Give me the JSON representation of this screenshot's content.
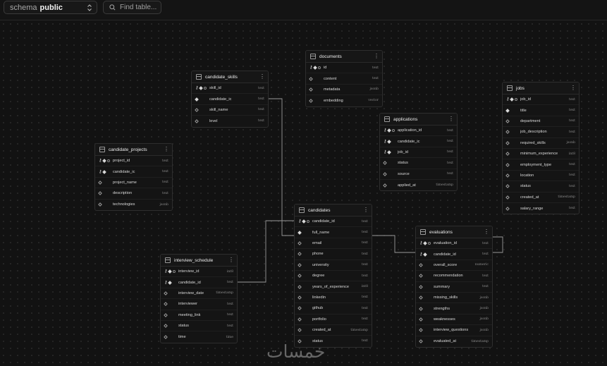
{
  "toolbar": {
    "schema_label": "schema",
    "schema_value": "public",
    "find_placeholder": "Find table..."
  },
  "tables": {
    "documents": {
      "name": "documents",
      "columns": [
        {
          "name": "id",
          "type": "text",
          "icons": [
            "key",
            "dia",
            "uniq"
          ]
        },
        {
          "name": "content",
          "type": "text",
          "icons": [
            "null"
          ]
        },
        {
          "name": "metadata",
          "type": "jsonb",
          "icons": [
            "null"
          ]
        },
        {
          "name": "embedding",
          "type": "vector",
          "icons": [
            "null"
          ]
        }
      ]
    },
    "candidate_skills": {
      "name": "candidate_skills",
      "columns": [
        {
          "name": "skill_id",
          "type": "text",
          "icons": [
            "key",
            "dia",
            "uniq"
          ]
        },
        {
          "name": "candidate_ic",
          "type": "text",
          "icons": [
            "dia"
          ]
        },
        {
          "name": "skill_name",
          "type": "text",
          "icons": [
            "null"
          ]
        },
        {
          "name": "level",
          "type": "text",
          "icons": [
            "null"
          ]
        }
      ]
    },
    "applications": {
      "name": "applications",
      "columns": [
        {
          "name": "application_id",
          "type": "text",
          "icons": [
            "key",
            "dia",
            "uniq"
          ]
        },
        {
          "name": "candidate_ic",
          "type": "text",
          "icons": [
            "key",
            "dia"
          ]
        },
        {
          "name": "job_id",
          "type": "text",
          "icons": [
            "key",
            "dia"
          ]
        },
        {
          "name": "status",
          "type": "text",
          "icons": [
            "null"
          ]
        },
        {
          "name": "source",
          "type": "text",
          "icons": [
            "null"
          ]
        },
        {
          "name": "applied_at",
          "type": "timestamp",
          "icons": [
            "null"
          ]
        }
      ]
    },
    "jobs": {
      "name": "jobs",
      "columns": [
        {
          "name": "job_id",
          "type": "text",
          "icons": [
            "key",
            "dia",
            "uniq"
          ]
        },
        {
          "name": "title",
          "type": "text",
          "icons": [
            "dia"
          ]
        },
        {
          "name": "department",
          "type": "text",
          "icons": [
            "null"
          ]
        },
        {
          "name": "job_description",
          "type": "text",
          "icons": [
            "null"
          ]
        },
        {
          "name": "required_skills",
          "type": "jsonb",
          "icons": [
            "null"
          ]
        },
        {
          "name": "minimum_experience",
          "type": "int8",
          "icons": [
            "null"
          ]
        },
        {
          "name": "employment_type",
          "type": "text",
          "icons": [
            "null"
          ]
        },
        {
          "name": "location",
          "type": "text",
          "icons": [
            "null"
          ]
        },
        {
          "name": "status",
          "type": "text",
          "icons": [
            "null"
          ]
        },
        {
          "name": "created_at",
          "type": "timestamp",
          "icons": [
            "null"
          ]
        },
        {
          "name": "salary_range",
          "type": "text",
          "icons": [
            "null"
          ]
        }
      ]
    },
    "candidate_projects": {
      "name": "candidate_projects",
      "columns": [
        {
          "name": "project_id",
          "type": "text",
          "icons": [
            "key",
            "dia",
            "uniq"
          ]
        },
        {
          "name": "candidate_ic",
          "type": "text",
          "icons": [
            "key",
            "dia"
          ]
        },
        {
          "name": "project_name",
          "type": "text",
          "icons": [
            "null"
          ]
        },
        {
          "name": "description",
          "type": "text",
          "icons": [
            "null"
          ]
        },
        {
          "name": "technologies",
          "type": "jsonb",
          "icons": [
            "null"
          ]
        }
      ]
    },
    "candidates": {
      "name": "candidates",
      "columns": [
        {
          "name": "candidate_id",
          "type": "text",
          "icons": [
            "key",
            "dia",
            "uniq"
          ]
        },
        {
          "name": "full_name",
          "type": "text",
          "icons": [
            "dia"
          ]
        },
        {
          "name": "email",
          "type": "text",
          "icons": [
            "null"
          ]
        },
        {
          "name": "phone",
          "type": "text",
          "icons": [
            "null"
          ]
        },
        {
          "name": "university",
          "type": "text",
          "icons": [
            "null"
          ]
        },
        {
          "name": "degree",
          "type": "text",
          "icons": [
            "null"
          ]
        },
        {
          "name": "years_of_experience",
          "type": "int8",
          "icons": [
            "null"
          ]
        },
        {
          "name": "linkedin",
          "type": "text",
          "icons": [
            "null"
          ]
        },
        {
          "name": "github",
          "type": "text",
          "icons": [
            "null"
          ]
        },
        {
          "name": "portfolio",
          "type": "text",
          "icons": [
            "null"
          ]
        },
        {
          "name": "created_at",
          "type": "timestamp",
          "icons": [
            "null"
          ]
        },
        {
          "name": "status",
          "type": "text",
          "icons": [
            "null"
          ]
        }
      ]
    },
    "interview_schedule": {
      "name": "interview_schedule",
      "columns": [
        {
          "name": "interview_id",
          "type": "int8",
          "icons": [
            "key",
            "dia",
            "uniq"
          ]
        },
        {
          "name": "candidate_id",
          "type": "text",
          "icons": [
            "key",
            "dia"
          ]
        },
        {
          "name": "interview_date",
          "type": "timestamp",
          "icons": [
            "null"
          ]
        },
        {
          "name": "interviewer",
          "type": "text",
          "icons": [
            "null"
          ]
        },
        {
          "name": "meeting_link",
          "type": "text",
          "icons": [
            "null"
          ]
        },
        {
          "name": "status",
          "type": "text",
          "icons": [
            "null"
          ]
        },
        {
          "name": "time",
          "type": "time",
          "icons": [
            "null"
          ]
        }
      ]
    },
    "evaluations": {
      "name": "evaluations",
      "columns": [
        {
          "name": "evaluation_id",
          "type": "text",
          "icons": [
            "key",
            "dia",
            "uniq"
          ]
        },
        {
          "name": "candidate_id",
          "type": "text",
          "icons": [
            "key",
            "dia"
          ]
        },
        {
          "name": "overall_score",
          "type": "numeric",
          "icons": [
            "null"
          ]
        },
        {
          "name": "recommendation",
          "type": "text",
          "icons": [
            "null"
          ]
        },
        {
          "name": "summary",
          "type": "text",
          "icons": [
            "null"
          ]
        },
        {
          "name": "missing_skills",
          "type": "jsonb",
          "icons": [
            "null"
          ]
        },
        {
          "name": "strengths",
          "type": "jsonb",
          "icons": [
            "null"
          ]
        },
        {
          "name": "weaknesses",
          "type": "jsonb",
          "icons": [
            "null"
          ]
        },
        {
          "name": "interview_questions",
          "type": "jsonb",
          "icons": [
            "null"
          ]
        },
        {
          "name": "evaluated_at",
          "type": "timestamp",
          "icons": [
            "null"
          ]
        }
      ]
    }
  },
  "watermark": "خمسات",
  "colors": {
    "background": "#121212",
    "table_bg": "#141414",
    "border": "#2e2e2e",
    "edge": "#9a9a9a"
  }
}
